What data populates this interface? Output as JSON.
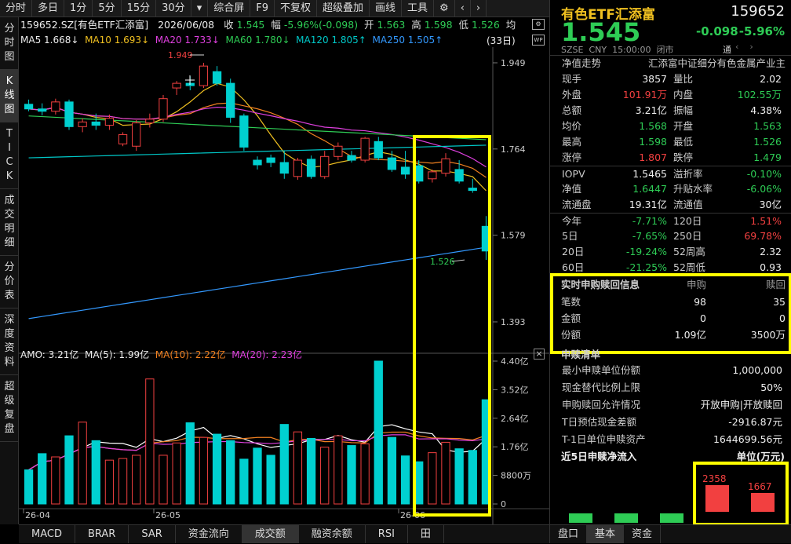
{
  "toolbar": {
    "items": [
      "分时",
      "多日",
      "1分",
      "5分",
      "15分",
      "30分",
      "▾",
      "综合屏",
      "F9",
      "不复权",
      "超级叠加",
      "画线",
      "工具",
      "⚙",
      "‹",
      "›"
    ]
  },
  "side_tabs": [
    "分时图",
    "K线图",
    "TICK",
    "成交明细",
    "分价表",
    "深度资料",
    "超级复盘"
  ],
  "info": {
    "code_name": "159652.SZ[有色ETF汇添富]",
    "date": "2026/06/08",
    "close_label": "收",
    "close": "1.545",
    "range_label": "幅",
    "change": "-5.96%(-0.098)",
    "open_label": "开",
    "open": "1.563",
    "high_label": "高",
    "high": "1.598",
    "low_label": "低",
    "low": "1.526",
    "avg_label": "均"
  },
  "ma_line": {
    "ma5": "MA5 1.668↓",
    "ma10": "MA10 1.693↓",
    "ma20": "MA20 1.733↓",
    "ma60": "MA60 1.780↓",
    "ma120": "MA120 1.805↑",
    "ma250": "MA250 1.505↑",
    "days": "(33日)"
  },
  "price_axis": [
    "1.949",
    "1.764",
    "1.579",
    "1.393"
  ],
  "price_annotations": {
    "high": "1.949",
    "low": "1.526"
  },
  "amo_line": {
    "amo": "AMO: 3.21亿",
    "ma5": "MA(5): 1.99亿",
    "ma10": "MA(10): 2.22亿",
    "ma20": "MA(20): 2.23亿"
  },
  "vol_axis": [
    "4.40亿",
    "3.52亿",
    "2.64亿",
    "1.76亿",
    "8800万",
    "0"
  ],
  "date_axis": [
    "26-04",
    "26-05",
    "26-06"
  ],
  "bottom_tabs": [
    "MACD",
    "BRAR",
    "SAR",
    "资金流向",
    "成交额",
    "融资余额",
    "RSI",
    "田"
  ],
  "colors": {
    "up": "#f24040",
    "down": "#2ecc55",
    "flat": "#00d0d0",
    "highlight": "#ffff00"
  },
  "chart_data": {
    "type": "candlestick",
    "ohlc": [
      [
        1.86,
        1.87,
        1.845,
        1.85
      ],
      [
        1.85,
        1.862,
        1.836,
        1.845
      ],
      [
        1.845,
        1.872,
        1.838,
        1.865
      ],
      [
        1.865,
        1.87,
        1.805,
        1.812
      ],
      [
        1.812,
        1.83,
        1.8,
        1.822
      ],
      [
        1.822,
        1.84,
        1.805,
        1.815
      ],
      [
        1.815,
        1.838,
        1.805,
        1.83
      ],
      [
        1.775,
        1.8,
        1.77,
        1.795
      ],
      [
        1.77,
        1.826,
        1.76,
        1.82
      ],
      [
        1.82,
        1.84,
        1.81,
        1.828
      ],
      [
        1.828,
        1.88,
        1.822,
        1.872
      ],
      [
        1.895,
        1.91,
        1.88,
        1.905
      ],
      [
        1.905,
        1.92,
        1.89,
        1.9
      ],
      [
        1.9,
        1.949,
        1.895,
        1.942
      ],
      [
        1.93,
        1.942,
        1.9,
        1.905
      ],
      [
        1.905,
        1.915,
        1.82,
        1.832
      ],
      [
        1.835,
        1.84,
        1.76,
        1.768
      ],
      [
        1.74,
        1.748,
        1.72,
        1.73
      ],
      [
        1.745,
        1.752,
        1.725,
        1.735
      ],
      [
        1.735,
        1.76,
        1.7,
        1.712
      ],
      [
        1.705,
        1.745,
        1.698,
        1.74
      ],
      [
        1.742,
        1.75,
        1.7,
        1.705
      ],
      [
        1.705,
        1.76,
        1.7,
        1.748
      ],
      [
        1.748,
        1.778,
        1.74,
        1.77
      ],
      [
        1.75,
        1.76,
        1.735,
        1.74
      ],
      [
        1.74,
        1.79,
        1.735,
        1.787
      ],
      [
        1.78,
        1.79,
        1.74,
        1.745
      ],
      [
        1.745,
        1.76,
        1.715,
        1.72
      ],
      [
        1.725,
        1.76,
        1.7,
        1.71
      ],
      [
        1.728,
        1.74,
        1.69,
        1.695
      ],
      [
        1.7,
        1.72,
        1.692,
        1.715
      ],
      [
        1.712,
        1.755,
        1.705,
        1.743
      ],
      [
        1.72,
        1.74,
        1.69,
        1.695
      ],
      [
        1.68,
        1.7,
        1.67,
        1.675
      ],
      [
        1.598,
        1.62,
        1.526,
        1.545
      ]
    ],
    "amount_yi": [
      1.05,
      1.55,
      1.45,
      2.1,
      2.52,
      1.95,
      1.35,
      1.4,
      1.5,
      3.85,
      1.5,
      1.88,
      2.5,
      2.05,
      2.15,
      1.95,
      1.38,
      1.72,
      1.5,
      2.45,
      2.22,
      2.02,
      1.75,
      2.1,
      1.8,
      1.85,
      4.4,
      2.05,
      1.48,
      1.3,
      1.58,
      1.9,
      1.7,
      1.65,
      3.21
    ],
    "ylim": [
      1.393,
      1.949
    ],
    "vol_ylim": [
      0,
      4.4
    ]
  },
  "right": {
    "name": "有色ETF汇添富",
    "code": "159652",
    "price": "1.545",
    "change": "-0.098",
    "pct": "-5.96%",
    "exchange": "SZSE",
    "currency": "CNY",
    "time": "15:00:00",
    "status": "闭市",
    "trade_flag": "通",
    "nav_link": "净值走势",
    "full_name": "汇添富中证细分有色金属产业主",
    "quote_rows": [
      {
        "l1": "现手",
        "v1": "3857",
        "c1": "w",
        "l2": "量比",
        "v2": "2.02",
        "c2": "w"
      },
      {
        "l1": "外盘",
        "v1": "101.91万",
        "c1": "r",
        "l2": "内盘",
        "v2": "102.55万",
        "c2": "g"
      },
      {
        "l1": "总额",
        "v1": "3.21亿",
        "c1": "w",
        "l2": "振幅",
        "v2": "4.38%",
        "c2": "w"
      },
      {
        "l1": "均价",
        "v1": "1.568",
        "c1": "g",
        "l2": "开盘",
        "v2": "1.563",
        "c2": "g"
      },
      {
        "l1": "最高",
        "v1": "1.598",
        "c1": "g",
        "l2": "最低",
        "v2": "1.526",
        "c2": "g"
      },
      {
        "l1": "涨停",
        "v1": "1.807",
        "c1": "r",
        "l2": "跌停",
        "v2": "1.479",
        "c2": "g"
      },
      {
        "l1": "IOPV",
        "v1": "1.5465",
        "c1": "w",
        "l2": "溢折率",
        "v2": "-0.10%",
        "c2": "g"
      },
      {
        "l1": "净值",
        "v1": "1.6447",
        "c1": "g",
        "l2": "升贴水率",
        "v2": "-6.06%",
        "c2": "g"
      },
      {
        "l1": "流通盘",
        "v1": "19.31亿",
        "c1": "w",
        "l2": "流通值",
        "v2": "30亿",
        "c2": "w"
      },
      {
        "l1": "今年",
        "v1": "-7.71%",
        "c1": "g",
        "l2": "120日",
        "v2": "1.51%",
        "c2": "r"
      },
      {
        "l1": "5日",
        "v1": "-7.65%",
        "c1": "g",
        "l2": "250日",
        "v2": "69.78%",
        "c2": "r"
      },
      {
        "l1": "20日",
        "v1": "-19.24%",
        "c1": "g",
        "l2": "52周高",
        "v2": "2.32",
        "c2": "w"
      },
      {
        "l1": "60日",
        "v1": "-21.25%",
        "c1": "g",
        "l2": "52周低",
        "v2": "0.93",
        "c2": "w"
      }
    ],
    "subscription": {
      "title": "实时申购赎回信息",
      "col1": "申购",
      "col2": "赎回",
      "rows": [
        {
          "label": "笔数",
          "a": "98",
          "b": "35"
        },
        {
          "label": "金额",
          "a": "0",
          "b": "0"
        },
        {
          "label": "份额",
          "a": "1.09亿",
          "b": "3500万"
        }
      ]
    },
    "list_title": "申赎清单",
    "list_rows": [
      {
        "label": "最小申赎单位份额",
        "value": "1,000,000"
      },
      {
        "label": "现金替代比例上限",
        "value": "50%"
      },
      {
        "label": "申购赎回允许情况",
        "value": "开放申购|开放赎回"
      },
      {
        "label": "T日预估现金差额",
        "value": "-2916.87元"
      },
      {
        "label": "T-1日单位申赎资产",
        "value": "1644699.56元"
      }
    ],
    "flow_title": "近5日申赎净流入",
    "flow_unit": "单位(万元)",
    "flow": {
      "values": [
        -1,
        -1,
        -1,
        2358,
        1667
      ],
      "labels": [
        "",
        "",
        "",
        "2358",
        "1667"
      ]
    },
    "bottom_tabs": [
      "盘口",
      "基本",
      "资金"
    ]
  }
}
